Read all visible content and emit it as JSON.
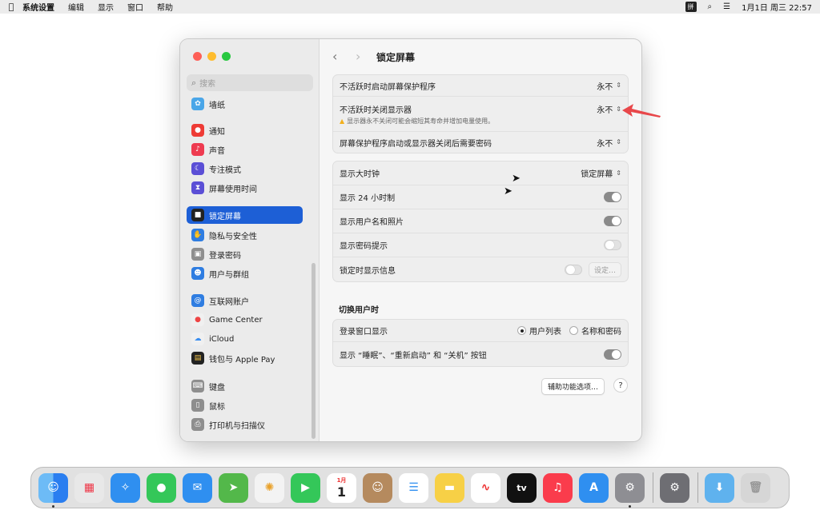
{
  "menubar": {
    "apple": "",
    "items": [
      "系统设置",
      "编辑",
      "显示",
      "窗口",
      "帮助"
    ],
    "ime": "拼",
    "clock": "1月1日 周三  22:57"
  },
  "sidebar": {
    "search_placeholder": "搜索",
    "items": [
      {
        "label": "墙纸",
        "icon": "wallpaper-icon",
        "color": "#4aa6e8"
      },
      {
        "label": "通知",
        "icon": "notifications-icon",
        "color": "#ee3b35"
      },
      {
        "label": "声音",
        "icon": "sound-icon",
        "color": "#ee3b50"
      },
      {
        "label": "专注模式",
        "icon": "focus-icon",
        "color": "#5b4fd6"
      },
      {
        "label": "屏幕使用时间",
        "icon": "screen-time-icon",
        "color": "#5b4fd6"
      },
      {
        "label": "锁定屏幕",
        "icon": "lock-icon",
        "color": "#222222"
      },
      {
        "label": "隐私与安全性",
        "icon": "privacy-hand-icon",
        "color": "#2f7de1"
      },
      {
        "label": "登录密码",
        "icon": "password-icon",
        "color": "#8e8e8e"
      },
      {
        "label": "用户与群组",
        "icon": "users-icon",
        "color": "#2f7de1"
      },
      {
        "label": "互联网账户",
        "icon": "internet-accounts-icon",
        "color": "#2f7de1"
      },
      {
        "label": "Game Center",
        "icon": "game-center-icon",
        "color": "#f0f0f0"
      },
      {
        "label": "iCloud",
        "icon": "icloud-icon",
        "color": "#f0f0f0"
      },
      {
        "label": "钱包与 Apple Pay",
        "icon": "wallet-icon",
        "color": "#222222"
      },
      {
        "label": "键盘",
        "icon": "keyboard-icon",
        "color": "#8e8e8e"
      },
      {
        "label": "鼠标",
        "icon": "mouse-icon",
        "color": "#8e8e8e"
      },
      {
        "label": "打印机与扫描仪",
        "icon": "printer-icon",
        "color": "#8e8e8e"
      }
    ]
  },
  "main": {
    "title": "锁定屏幕",
    "group1": {
      "screensaver_label": "不活跃时启动屏幕保护程序",
      "screensaver_value": "永不",
      "display_off_label": "不活跃时关闭显示器",
      "display_off_value": "永不",
      "display_off_note": "显示器永不关闭可能会缩短其寿命并增加电量使用。",
      "password_label": "屏幕保护程序启动或显示器关闭后需要密码",
      "password_value": "永不"
    },
    "group2": {
      "large_clock_label": "显示大时钟",
      "large_clock_value": "锁定屏幕",
      "clock24_label": "显示 24 小时制",
      "clock24_on": true,
      "username_photo_label": "显示用户名和照片",
      "username_photo_on": true,
      "password_hint_label": "显示密码提示",
      "password_hint_on": false,
      "lock_message_label": "锁定时显示信息",
      "lock_message_on": false,
      "settings_button": "设定…"
    },
    "switch_user_title": "切换用户时",
    "group3": {
      "login_window_label": "登录窗口显示",
      "option_list": "用户列表",
      "option_name_password": "名称和密码",
      "selected": "用户列表",
      "buttons_label": "显示 “睡眠”、“重新启动” 和 “关机” 按钮",
      "buttons_on": true
    },
    "accessibility_button": "辅助功能选项…",
    "help_button": "?"
  },
  "dock": {
    "apps": [
      {
        "name": "finder-icon",
        "color": "#3b8ef0"
      },
      {
        "name": "launchpad-icon",
        "color": "#e8e8e8"
      },
      {
        "name": "safari-icon",
        "color": "#2f8ff0"
      },
      {
        "name": "messages-icon",
        "color": "#34c759"
      },
      {
        "name": "mail-icon",
        "color": "#2f8ff0"
      },
      {
        "name": "maps-icon",
        "color": "#53b84a"
      },
      {
        "name": "photos-icon",
        "color": "#f3f3f3"
      },
      {
        "name": "facetime-icon",
        "color": "#34c759"
      },
      {
        "name": "calendar-icon",
        "color": "#ffffff"
      },
      {
        "name": "contacts-icon",
        "color": "#b58a5e"
      },
      {
        "name": "reminders-icon",
        "color": "#ffffff"
      },
      {
        "name": "notes-icon",
        "color": "#f7d046"
      },
      {
        "name": "freeform-icon",
        "color": "#ffffff"
      },
      {
        "name": "tv-icon",
        "color": "#111111"
      },
      {
        "name": "music-icon",
        "color": "#fa3c4c"
      },
      {
        "name": "app-store-icon",
        "color": "#2f8ff0"
      },
      {
        "name": "system-settings-icon",
        "color": "#8e8e93"
      }
    ],
    "recent_apps": [
      {
        "name": "system-settings-recent-icon",
        "color": "#6e6e73"
      }
    ],
    "stack_apps": [
      {
        "name": "downloads-folder-icon",
        "color": "#5fb2ee"
      },
      {
        "name": "trash-icon",
        "color": "#d6d6d6"
      }
    ],
    "calendar_month": "1月",
    "calendar_day": "1",
    "tv_label": "tv"
  }
}
